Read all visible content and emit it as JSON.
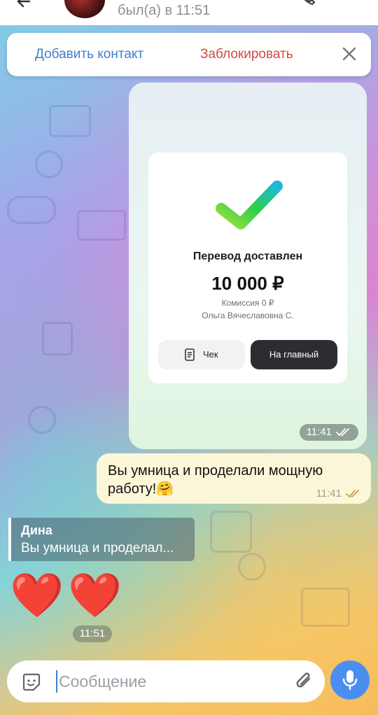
{
  "header": {
    "status": "был(а) в 11:51"
  },
  "action_bar": {
    "add_contact": "Добавить контакт",
    "block": "Заблокировать"
  },
  "transfer": {
    "title": "Перевод доставлен",
    "amount": "10 000 ₽",
    "fee": "Комиссия 0 ₽",
    "recipient": "Ольга Вячеславовна С.",
    "receipt_button": "Чек",
    "home_button": "На главный",
    "time": "11:41"
  },
  "outgoing": {
    "text": "Вы умница и проделали мощную работу!🤗",
    "time": "11:41"
  },
  "reply": {
    "name": "Дина",
    "text": "Вы умница и проделал..."
  },
  "hearts": {
    "emoji": "❤️❤️",
    "time": "11:51"
  },
  "composer": {
    "placeholder": "Сообщение"
  },
  "colors": {
    "link_blue": "#3e7fcb",
    "block_red": "#d24a43",
    "mic_blue": "#4a8ff0",
    "outgoing_bubble": "#fdf7d9"
  }
}
